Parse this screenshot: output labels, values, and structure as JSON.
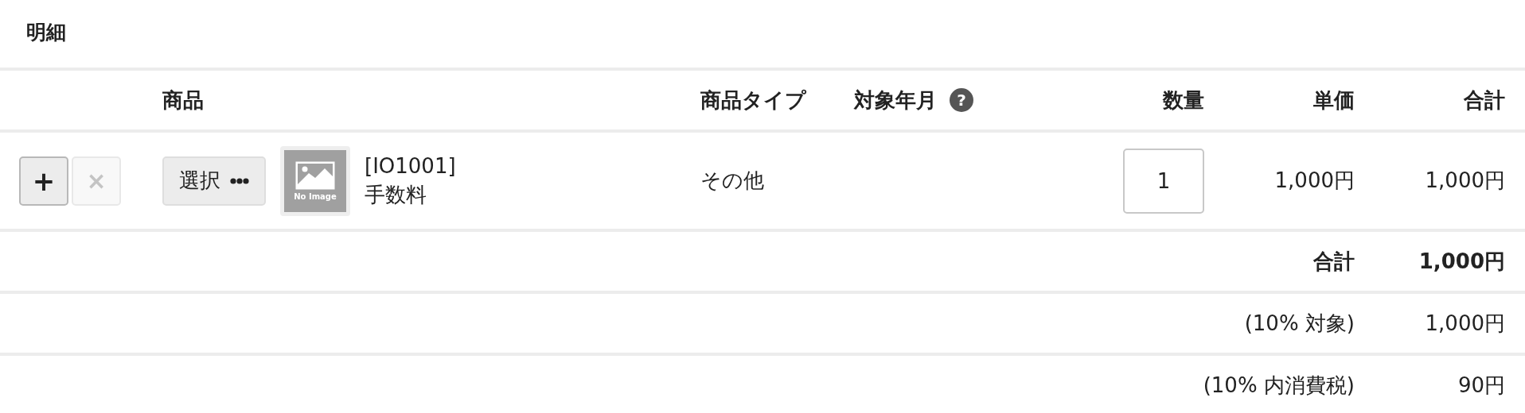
{
  "section_title": "明細",
  "table": {
    "columns": [
      {
        "label": "商品"
      },
      {
        "label": "商品タイプ"
      },
      {
        "label": "対象年月",
        "help_icon": "?"
      },
      {
        "label": "数量"
      },
      {
        "label": "単価"
      },
      {
        "label": "合計"
      }
    ],
    "rows": [
      {
        "add_button": "+",
        "remove_button": "×",
        "remove_disabled": true,
        "select_button": "選択",
        "image_placeholder": "No Image",
        "code": "[IO1001]",
        "name": "手数料",
        "type": "その他",
        "quantity": "1",
        "unit_price": "1,000円",
        "total": "1,000円"
      }
    ]
  },
  "summary": [
    {
      "label": "合計",
      "value": "1,000円",
      "bold": true
    },
    {
      "label": "(10% 対象)",
      "value": "1,000円",
      "bold": false
    },
    {
      "label": "(10% 内消費税)",
      "value": "90円",
      "bold": false
    }
  ]
}
